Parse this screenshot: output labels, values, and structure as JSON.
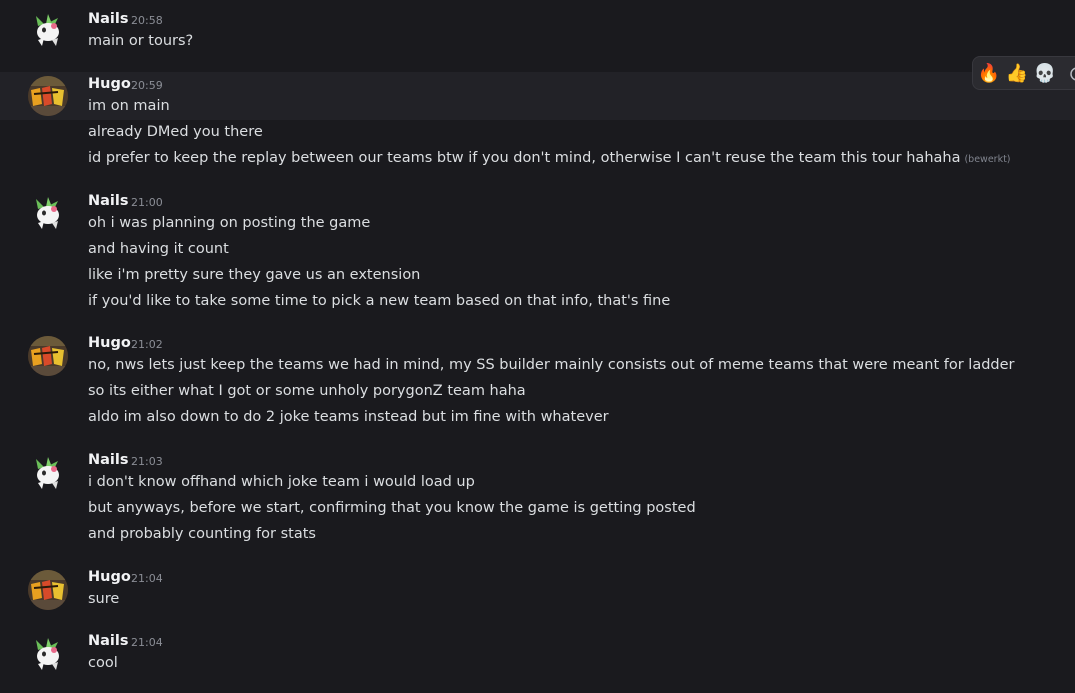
{
  "reactions": {
    "fire": "🔥",
    "thumbs_up": "👍",
    "skull": "💀"
  },
  "groups": [
    {
      "username": "Nails",
      "time": "20:58",
      "lines": [
        "main or tours?"
      ]
    },
    {
      "username": "Hugo",
      "time": "20:59",
      "lines": [
        "im on main",
        "already DMed you there",
        "id prefer to keep the replay between our teams btw if you don't mind, otherwise I can't reuse the team this tour hahaha"
      ],
      "edited": "(bewerkt)"
    },
    {
      "username": "Nails",
      "time": "21:00",
      "lines": [
        "oh i was planning on posting the game",
        "and having it count",
        "like i'm pretty sure they gave us an extension",
        "if you'd like to take some time to pick a new team based on that info, that's fine"
      ]
    },
    {
      "username": "Hugo",
      "time": "21:02",
      "lines": [
        "no, nws lets just keep the teams we had in mind, my SS builder mainly consists out of meme teams that were meant for ladder",
        "so its either what I got or some unholy porygonZ team haha",
        "aldo im also down to do 2 joke teams instead but im fine with whatever"
      ]
    },
    {
      "username": "Nails",
      "time": "21:03",
      "lines": [
        "i don't know offhand which joke team i would load up",
        "but anyways, before we start, confirming that you know the game is getting posted",
        "and probably counting for stats"
      ]
    },
    {
      "username": "Hugo",
      "time": "21:04",
      "lines": [
        "sure"
      ]
    },
    {
      "username": "Nails",
      "time": "21:04",
      "lines": [
        "cool"
      ]
    }
  ],
  "colors": {
    "background": "#1a1a1e",
    "hover_background": "#222227",
    "username": "#f2f3f5",
    "message_text": "#dbdee1",
    "timestamp": "#8b8e96"
  }
}
